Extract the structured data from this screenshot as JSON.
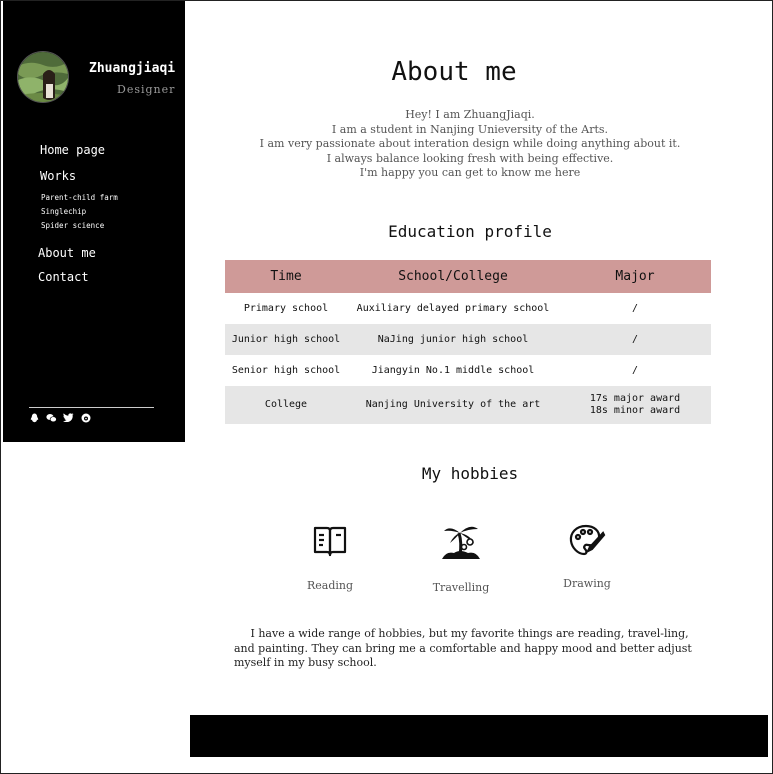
{
  "sidebar": {
    "name": "Zhuangjiaqi",
    "role": "Designer",
    "nav": {
      "home": "Home page",
      "works": "Works",
      "works_items": [
        "Parent-child farm",
        "Singlechip",
        "Spider science"
      ],
      "about": "About me",
      "contact": "Contact"
    },
    "social_icons": [
      "qq-icon",
      "wechat-icon",
      "twitter-icon",
      "weibo-icon"
    ]
  },
  "main": {
    "title": "About me",
    "intro": [
      "Hey! I am ZhuangJiaqi.",
      "I am a student in Nanjing Unieversity of the Arts.",
      "I am very passionate about interation design while doing anything about it.",
      "I always balance looking fresh with being effective.",
      "I'm happy you can get to know me here"
    ],
    "education": {
      "title": "Education profile",
      "headers": [
        "Time",
        "School/College",
        "Major"
      ],
      "rows": [
        [
          "Primary school",
          "Auxiliary delayed primary school",
          "/"
        ],
        [
          "Junior high school",
          "NaJing junior high school",
          "/"
        ],
        [
          "Senior high school",
          "Jiangyin No.1 middle school",
          "/"
        ],
        [
          "College",
          "Nanjing University of the art",
          "17s major award",
          "18s minor award"
        ]
      ],
      "header_color": "#cf9a98",
      "stripe_color": "#e6e6e6"
    },
    "hobbies": {
      "title": "My hobbies",
      "items": [
        {
          "label": "Reading",
          "icon": "book-icon"
        },
        {
          "label": "Travelling",
          "icon": "palm-tree-icon"
        },
        {
          "label": "Drawing",
          "icon": "palette-icon"
        }
      ],
      "description": "I have a wide range of hobbies, but my favorite things are reading, travel-ling, and painting. They can bring me a comfortable and happy mood and better adjust myself in my busy school."
    }
  },
  "colors": {
    "sidebar_bg": "#000000",
    "footer_bg": "#000000",
    "accent": "#cf9a98"
  }
}
